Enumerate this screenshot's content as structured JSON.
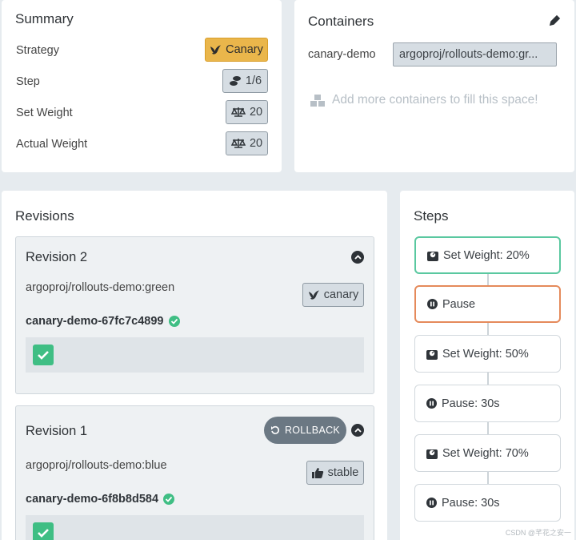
{
  "summary": {
    "title": "Summary",
    "rows": [
      {
        "label": "Strategy",
        "value": "Canary",
        "icon": "bird-icon"
      },
      {
        "label": "Step",
        "value": "1/6",
        "icon": "shoe-prints-icon"
      },
      {
        "label": "Set Weight",
        "value": "20",
        "icon": "balance-scale-icon"
      },
      {
        "label": "Actual Weight",
        "value": "20",
        "icon": "balance-scale-icon"
      }
    ]
  },
  "containers": {
    "title": "Containers",
    "edit_icon": "pencil-icon",
    "items": [
      {
        "name": "canary-demo",
        "image": "argoproj/rollouts-demo:gr..."
      }
    ],
    "add_more_text": "Add more containers to fill this space!"
  },
  "revisions": {
    "title": "Revisions",
    "items": [
      {
        "title": "Revision 2",
        "image": "argoproj/rollouts-demo:green",
        "tag": "canary",
        "replicaset": "canary-demo-67fc7c4899"
      },
      {
        "title": "Revision 1",
        "image": "argoproj/rollouts-demo:blue",
        "tag": "stable",
        "replicaset": "canary-demo-6f8b8d584",
        "rollback_label": "ROLLBACK"
      }
    ]
  },
  "steps": {
    "title": "Steps",
    "items": [
      {
        "label": "Set Weight: 20%",
        "icon": "weight-icon",
        "state": "complete"
      },
      {
        "label": "Pause",
        "icon": "pause-circle-icon",
        "state": "current"
      },
      {
        "label": "Set Weight: 50%",
        "icon": "weight-icon",
        "state": "pending"
      },
      {
        "label": "Pause: 30s",
        "icon": "pause-circle-icon",
        "state": "pending"
      },
      {
        "label": "Set Weight: 70%",
        "icon": "weight-icon",
        "state": "pending"
      },
      {
        "label": "Pause: 30s",
        "icon": "pause-circle-icon",
        "state": "pending"
      }
    ]
  },
  "colors": {
    "canary": "#eab64b",
    "complete": "#5ac8a0",
    "current": "#e58a5b",
    "success": "#3fbe84"
  },
  "watermark": "CSDN @芊花之安一"
}
